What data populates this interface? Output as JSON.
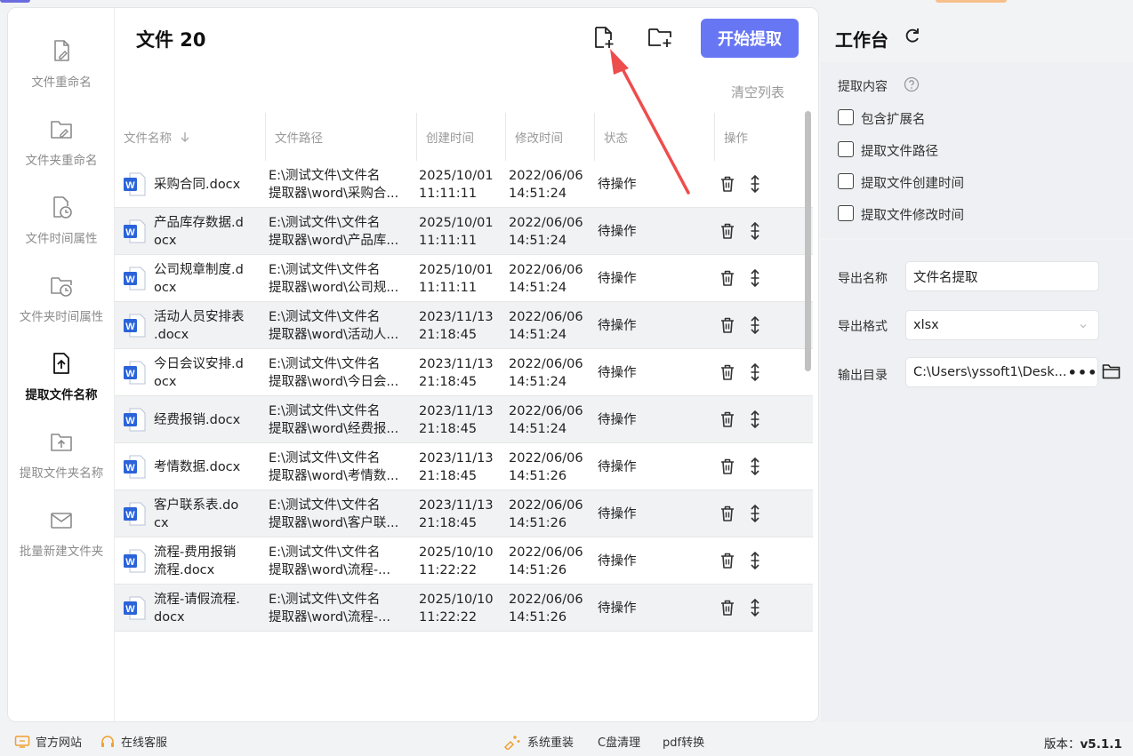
{
  "header": {
    "file_label": "文件 20",
    "start_button": "开始提取",
    "clear_list": "清空列表"
  },
  "sidebar": {
    "items": [
      {
        "label": "文件重命名",
        "icon": "file-edit-icon",
        "active": false
      },
      {
        "label": "文件夹重命名",
        "icon": "folder-edit-icon",
        "active": false
      },
      {
        "label": "文件时间属性",
        "icon": "file-clock-icon",
        "active": false
      },
      {
        "label": "文件夹时间属性",
        "icon": "folder-clock-icon",
        "active": false
      },
      {
        "label": "提取文件名称",
        "icon": "file-upload-icon",
        "active": true
      },
      {
        "label": "提取文件夹名称",
        "icon": "folder-upload-icon",
        "active": false
      },
      {
        "label": "批量新建文件夹",
        "icon": "mail-folder-icon",
        "active": false
      }
    ]
  },
  "table": {
    "headers": {
      "name": "文件名称",
      "path": "文件路径",
      "created": "创建时间",
      "modified": "修改时间",
      "status": "状态",
      "actions": "操作"
    },
    "rows": [
      {
        "name1": "采购合同.docx",
        "name2": "",
        "path1": "E:\\测试文件\\文件名",
        "path2": "提取器\\word\\采购合...",
        "c1": "2025/10/01",
        "c2": "11:11:11",
        "m1": "2022/06/06",
        "m2": "14:51:24",
        "status": "待操作"
      },
      {
        "name1": "产品库存数据.d",
        "name2": "ocx",
        "path1": "E:\\测试文件\\文件名",
        "path2": "提取器\\word\\产品库...",
        "c1": "2025/10/01",
        "c2": "11:11:11",
        "m1": "2022/06/06",
        "m2": "14:51:24",
        "status": "待操作"
      },
      {
        "name1": "公司规章制度.d",
        "name2": "ocx",
        "path1": "E:\\测试文件\\文件名",
        "path2": "提取器\\word\\公司规...",
        "c1": "2025/10/01",
        "c2": "11:11:11",
        "m1": "2022/06/06",
        "m2": "14:51:24",
        "status": "待操作"
      },
      {
        "name1": "活动人员安排表",
        "name2": ".docx",
        "path1": "E:\\测试文件\\文件名",
        "path2": "提取器\\word\\活动人...",
        "c1": "2023/11/13",
        "c2": "21:18:45",
        "m1": "2022/06/06",
        "m2": "14:51:24",
        "status": "待操作"
      },
      {
        "name1": "今日会议安排.d",
        "name2": "ocx",
        "path1": "E:\\测试文件\\文件名",
        "path2": "提取器\\word\\今日会...",
        "c1": "2023/11/13",
        "c2": "21:18:45",
        "m1": "2022/06/06",
        "m2": "14:51:24",
        "status": "待操作"
      },
      {
        "name1": "经费报销.docx",
        "name2": "",
        "path1": "E:\\测试文件\\文件名",
        "path2": "提取器\\word\\经费报...",
        "c1": "2023/11/13",
        "c2": "21:18:45",
        "m1": "2022/06/06",
        "m2": "14:51:24",
        "status": "待操作"
      },
      {
        "name1": "考情数据.docx",
        "name2": "",
        "path1": "E:\\测试文件\\文件名",
        "path2": "提取器\\word\\考情数...",
        "c1": "2023/11/13",
        "c2": "21:18:45",
        "m1": "2022/06/06",
        "m2": "14:51:26",
        "status": "待操作"
      },
      {
        "name1": "客户联系表.do",
        "name2": "cx",
        "path1": "E:\\测试文件\\文件名",
        "path2": "提取器\\word\\客户联...",
        "c1": "2023/11/13",
        "c2": "21:18:45",
        "m1": "2022/06/06",
        "m2": "14:51:26",
        "status": "待操作"
      },
      {
        "name1": "流程-费用报销",
        "name2": "流程.docx",
        "path1": "E:\\测试文件\\文件名",
        "path2": "提取器\\word\\流程-...",
        "c1": "2025/10/10",
        "c2": "11:22:22",
        "m1": "2022/06/06",
        "m2": "14:51:26",
        "status": "待操作"
      },
      {
        "name1": "流程-请假流程.",
        "name2": "docx",
        "path1": "E:\\测试文件\\文件名",
        "path2": "提取器\\word\\流程-...",
        "c1": "2025/10/10",
        "c2": "11:22:22",
        "m1": "2022/06/06",
        "m2": "14:51:26",
        "status": "待操作"
      }
    ]
  },
  "workbench": {
    "title": "工作台",
    "extract_label": "提取内容",
    "options": [
      {
        "label": "包含扩展名",
        "checked": false
      },
      {
        "label": "提取文件路径",
        "checked": false
      },
      {
        "label": "提取文件创建时间",
        "checked": false
      },
      {
        "label": "提取文件修改时间",
        "checked": false
      }
    ],
    "export_name_label": "导出名称",
    "export_name_value": "文件名提取",
    "export_format_label": "导出格式",
    "export_format_value": "xlsx",
    "output_dir_label": "输出目录",
    "output_dir_value": "C:\\Users\\yssoft1\\Desk...",
    "more_button": "•••"
  },
  "footer": {
    "website": "官方网站",
    "support": "在线客服",
    "reinstall": "系统重装",
    "cclean": "C盘清理",
    "pdf": "pdf转换",
    "version_label": "版本：",
    "version_value": "v5.1.1"
  },
  "colors": {
    "accent": "#6777f4",
    "word_blue": "#2b63d9",
    "arrow_red": "#ee4d4d"
  }
}
